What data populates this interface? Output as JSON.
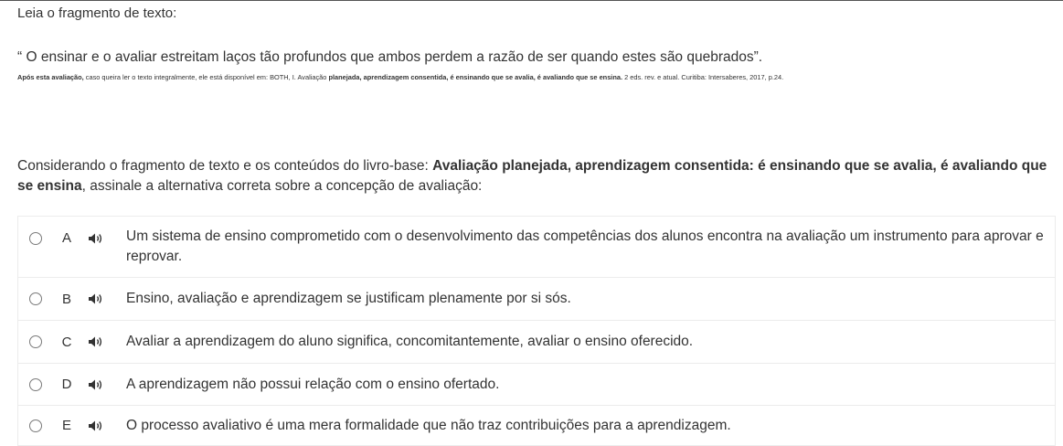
{
  "instruction": "Leia o fragmento de texto:",
  "quote": "“ O ensinar e o avaliar estreitam laços tão profundos que ambos perdem a razão de ser quando estes são quebrados”.",
  "source": {
    "prefix": "Após esta avaliação,",
    "middle": " caso queira ler o texto integralmente, ele está disponível em: BOTH, I. Avaliação ",
    "bold_title": "planejada, aprendizagem consentida, é ensinando que se avalia, é avaliando que se ensina.",
    "suffix": " 2 eds. rev. e atual. Curitiba: Intersaberes, 2017, p.24."
  },
  "question": {
    "part1": "Considerando o fragmento de texto e os conteúdos do livro-base: ",
    "bold": "Avaliação planejada, aprendizagem consentida: é ensinando que se avalia, é avaliando que se ensina",
    "part2": ", assinale a alternativa correta sobre a concepção de avaliação:"
  },
  "options": [
    {
      "letter": "A",
      "text": "Um sistema de ensino comprometido com o desenvolvimento das competências dos alunos encontra na avaliação um instrumento para aprovar e reprovar."
    },
    {
      "letter": "B",
      "text": "Ensino, avaliação e aprendizagem se justificam plenamente por si sós."
    },
    {
      "letter": "C",
      "text": "Avaliar a aprendizagem do aluno significa, concomitantemente, avaliar o ensino oferecido."
    },
    {
      "letter": "D",
      "text": "A aprendizagem não possui relação com o ensino ofertado."
    },
    {
      "letter": "E",
      "text": "O processo avaliativo é uma mera formalidade que não traz contribuições para a aprendizagem."
    }
  ],
  "icons": {
    "speaker": "speaker-icon",
    "radio": "radio-button"
  },
  "colors": {
    "text": "#333333",
    "border": "#ececec",
    "icon": "#333333"
  }
}
